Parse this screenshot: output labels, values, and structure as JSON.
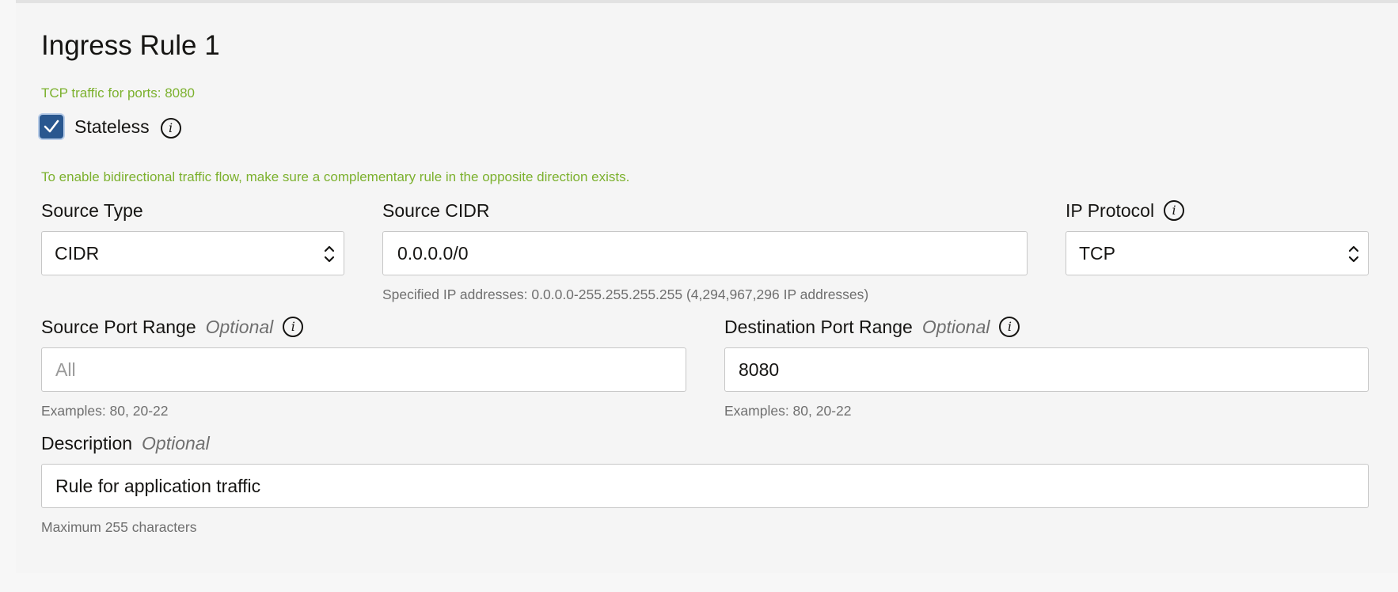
{
  "rule": {
    "title": "Ingress Rule 1",
    "summary": "TCP traffic for ports: 8080",
    "stateless": {
      "label": "Stateless",
      "checked": true,
      "info_icon": "info-icon"
    },
    "bidirectional_note": "To enable bidirectional traffic flow, make sure a complementary rule in the opposite direction exists."
  },
  "fields": {
    "source_type": {
      "label": "Source Type",
      "value": "CIDR"
    },
    "source_cidr": {
      "label": "Source CIDR",
      "value": "0.0.0.0/0",
      "helper": "Specified IP addresses: 0.0.0.0-255.255.255.255 (4,294,967,296 IP addresses)"
    },
    "ip_protocol": {
      "label": "IP Protocol",
      "value": "TCP",
      "info_icon": "info-icon"
    },
    "source_port_range": {
      "label": "Source Port Range",
      "optional": "Optional",
      "placeholder": "All",
      "value": "",
      "helper": "Examples: 80, 20-22"
    },
    "destination_port_range": {
      "label": "Destination Port Range",
      "optional": "Optional",
      "value": "8080",
      "helper": "Examples: 80, 20-22"
    },
    "description": {
      "label": "Description",
      "optional": "Optional",
      "value": "Rule for application traffic",
      "helper": "Maximum 255 characters"
    }
  },
  "colors": {
    "accent_green": "#7cb12e",
    "checkbox_blue": "#29578f"
  }
}
